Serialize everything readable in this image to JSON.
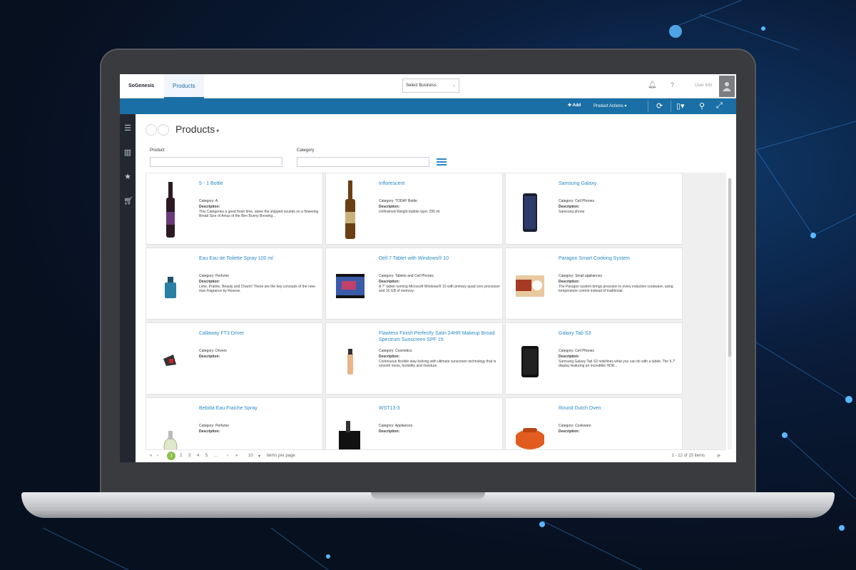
{
  "topbar": {
    "brand": "SoGenesis",
    "nav_products": "Products",
    "company": "Select Business",
    "user": "User Info"
  },
  "toolbar": {
    "add_label": "Add",
    "actions_label": "Product Actions ▾"
  },
  "page": {
    "title": "Products"
  },
  "filters": {
    "product_label": "Product",
    "category_label": "Category",
    "product_value": "",
    "category_value": ""
  },
  "products": [
    {
      "name": "5 - 1 Bottle",
      "category": "Category: A",
      "desc_label": "Description:",
      "desc": "This Categories a good fresh time, alone the shipped sounds on a flowering Bread Size of Amus of the Ben Bunny Brewing..."
    },
    {
      "name": "Inflorescent",
      "category": "Category: TODAY Bottle",
      "desc_label": "Description:",
      "desc": "Unfinished Weight bubble type: 295 ml"
    },
    {
      "name": "Samsung Galaxy",
      "category": "Category: Cell Phones",
      "desc_label": "Description:",
      "desc": "Samsung phone"
    },
    {
      "name": "Eau Eau de Toilette Spray 100 ml",
      "category": "Category: Perfume",
      "desc_label": "Description:",
      "desc": "Lime, Praline, Beauty and Charm! These are the key concepts of the new-man fragrance by Reseas."
    },
    {
      "name": "Dell 7 Tablet with Windows® 10",
      "category": "Category: Tablets and Cell Phones",
      "desc_label": "Description:",
      "desc": "A 7\" tablet running Microsoft Windows® 10 with primary quad core processor and 16 GB of memory."
    },
    {
      "name": "Paragon Smart Cooking System",
      "category": "Category: Small appliances",
      "desc_label": "Description:",
      "desc": "The Paragon system brings precision to every induction cookware, using temperature control instead of traditional."
    },
    {
      "name": "Callaway FT3 Driver",
      "category": "Category: Drivers",
      "desc_label": "Description:",
      "desc": ""
    },
    {
      "name": "Flawless Finish Perfectly Satin 24HR Makeup Broad Spectrum Sunscreen SPF 15",
      "category": "Category: Cosmetics",
      "desc_label": "Description:",
      "desc": "Continuous flexible stay-looking with ultimate sunscreen technology that is smooth mess, humidity and moisture."
    },
    {
      "name": "Galaxy Tab S3",
      "category": "Category: Cell Phones",
      "desc_label": "Description:",
      "desc": "Samsung Galaxy Tab S3 redefines what you can do with a tablet. The 9.7\" display featuring an incredible HDR..."
    },
    {
      "name": "Bebida Eau Fraiche Spray",
      "category": "Category: Perfume",
      "desc_label": "Description:",
      "desc": ""
    },
    {
      "name": "WST13-3",
      "category": "Category: Appliances",
      "desc_label": "Description:",
      "desc": ""
    },
    {
      "name": "Round Dutch Oven",
      "category": "Category: Cookware",
      "desc_label": "Description:",
      "desc": ""
    }
  ],
  "pager": {
    "current": "1",
    "pages": [
      "2",
      "3",
      "4",
      "5",
      "...",
      "›",
      "»"
    ],
    "per_page": "10",
    "per_page_label": "items per page",
    "info": "1 - 12 of 15 items"
  },
  "icons": [
    "menu-icon",
    "grid-icon",
    "star-icon",
    "cart-icon",
    "bell-icon",
    "help-icon",
    "refresh-icon",
    "file-icon",
    "search-icon",
    "expand-icon",
    "plus-icon"
  ],
  "colors": {
    "accent": "#1a6fa6",
    "link": "#2a8bc9",
    "rail": "#22282f"
  }
}
